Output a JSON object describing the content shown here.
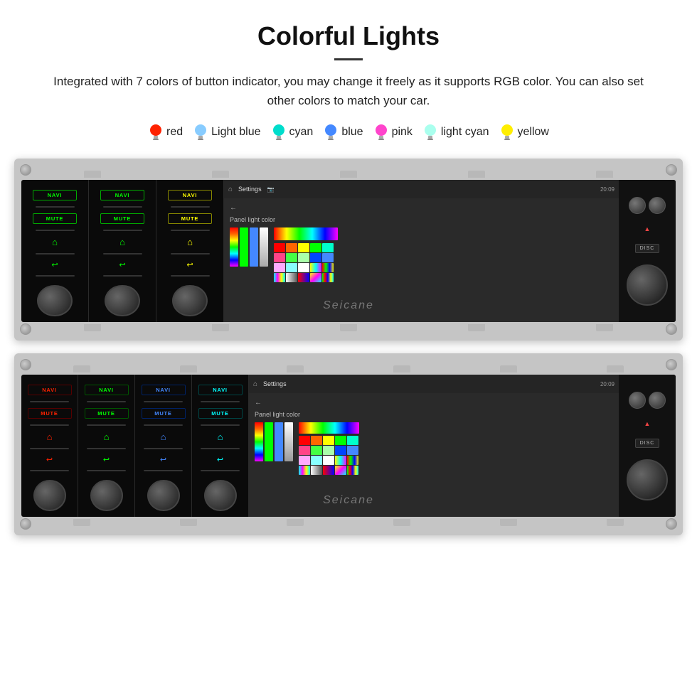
{
  "header": {
    "title": "Colorful Lights",
    "description": "Integrated with 7 colors of button indicator, you may change it freely as it supports RGB color. You can also set other colors to match your car."
  },
  "colors": [
    {
      "name": "red",
      "label": "red",
      "hex": "#ff2200"
    },
    {
      "name": "light-blue",
      "label": "Light blue",
      "hex": "#88ccff"
    },
    {
      "name": "cyan",
      "label": "cyan",
      "hex": "#00ffff"
    },
    {
      "name": "blue",
      "label": "blue",
      "hex": "#4488ff"
    },
    {
      "name": "pink",
      "label": "pink",
      "hex": "#ff44cc"
    },
    {
      "name": "light-cyan",
      "label": "light cyan",
      "hex": "#aaffee"
    },
    {
      "name": "yellow",
      "label": "yellow",
      "hex": "#ffee00"
    }
  ],
  "top_device": {
    "panels": [
      {
        "color": "green",
        "navi": "NAVI",
        "mute": "MUTE"
      },
      {
        "color": "green",
        "navi": "NAVI",
        "mute": "MUTE"
      },
      {
        "color": "yellow",
        "navi": "NAVI",
        "mute": "MUTE"
      }
    ],
    "screen": {
      "title": "Settings",
      "time": "20:09",
      "panel_color_title": "Panel light color"
    }
  },
  "bottom_device": {
    "panels": [
      {
        "color": "red",
        "navi": "NAVI",
        "mute": "MUTE"
      },
      {
        "color": "green",
        "navi": "NAVI",
        "mute": "MUTE"
      },
      {
        "color": "blue",
        "navi": "NAVI",
        "mute": "MUTE"
      },
      {
        "color": "cyan",
        "navi": "NAVI",
        "mute": "MUTE"
      }
    ],
    "screen": {
      "title": "Settings",
      "time": "20:09",
      "panel_color_title": "Panel light color"
    }
  },
  "watermark": "Seicane",
  "buttons": {
    "disc": "DISC"
  }
}
